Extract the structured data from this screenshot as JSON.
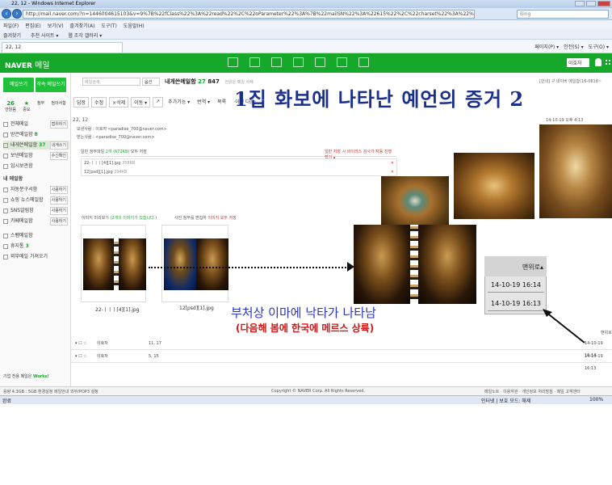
{
  "browser": {
    "title": "22, 12 - Windows Internet Explorer",
    "url": "http://mail.naver.com/?n=1446004615103&v=9%7B%22fClass%22%3A%22read%22%2C%22oParameter%22%3A%7B%22mailSN%22%3A%22615%22%2C%22charset%22%3A%22%22%2C%22prevNextMail%22%3Atrue%2C%22threadMail%22%3Atrue%2C%22p",
    "search_placeholder": "Bing",
    "menu": [
      "파일(F)",
      "편집(E)",
      "보기(V)",
      "즐겨찾기(A)",
      "도구(T)",
      "도움말(H)"
    ],
    "favorites_label": "즐겨찾기",
    "fav_items": [
      "추천 사이트 ▾",
      "웹 조각 갤러리 ▾"
    ],
    "tab_label": "22, 12",
    "tab_tools": [
      "페이지(P) ▾",
      "안전(S) ▾",
      "도구(O) ▾"
    ]
  },
  "naver": {
    "logo": "NAVER",
    "logo_sub": "메일",
    "user_label": "이호자"
  },
  "sidebar": {
    "write_button": "메일쓰기",
    "self_button": "작속 메일쓰기",
    "stats": [
      {
        "value": "26",
        "label": "안읽음"
      },
      {
        "value": "★",
        "label": "중요"
      },
      {
        "value": "",
        "label": "첨부"
      },
      {
        "value": "",
        "label": "첨아서함"
      }
    ],
    "mailboxes": [
      {
        "label": "전체메일",
        "count": "",
        "side": "캡위하기"
      },
      {
        "label": "받은메일함",
        "count": "8",
        "side": ""
      },
      {
        "label": "내게쓴메일함",
        "count": "37",
        "side": "내게쓰기"
      },
      {
        "label": "보낸메일함",
        "count": "",
        "side": "수신확인"
      },
      {
        "label": "임시보관함",
        "count": "",
        "side": ""
      }
    ],
    "my_section": "내 메일함",
    "my_boxes": [
      {
        "label": "자동분구서함",
        "side": "사용하기"
      },
      {
        "label": "쇼핑 뉴스메일함",
        "side": "사용하기"
      },
      {
        "label": "SNS알림함",
        "side": "사용하기"
      },
      {
        "label": "카페메일함",
        "side": "사용하기"
      }
    ],
    "other_boxes": [
      {
        "label": "스팸메일함",
        "count": ""
      },
      {
        "label": "휴지통",
        "count": "3"
      },
      {
        "label": "외부메일 가져오기",
        "count": ""
      }
    ],
    "footer": "기업 전용 메일은",
    "footer_brand": "Works!"
  },
  "mail": {
    "search_placeholder": "메일검색",
    "search_option": "옵션",
    "folder": "내게쓴메일함",
    "folder_count": "27",
    "folder_total": "847",
    "folder_hint": "안읽은 메일 삭제",
    "right_info": "[안내] 구 네이버 메일함(16-0818~",
    "toolbar": [
      "답장",
      "수정",
      "×삭제",
      "이동 ▾",
      "↗",
      "추가기능 ▾",
      "번역 ▾",
      "목록",
      "·이전 다음·"
    ],
    "date": "22, 12",
    "date_right": "14-10-19 오후 4:13",
    "sender_label": "보낸사람 : ",
    "sender": "이호자 <paradise_700@naver.com>",
    "receiver_label": "받는사람 : ",
    "receiver": "<paradise_700@naver.com>",
    "attach_title": "일반 첨부파일",
    "attach_count": "2개 (672KB)",
    "attach_save": "모두 저장",
    "attach_note": "일반 저장 시 바이러스 검사가 자동 진행",
    "attach_note2": "접기 ▴",
    "attachments": [
      "22-ㅣㅣㅣ[4][1].jpg",
      "12[psd][1].jpg"
    ],
    "attachment_sizes": [
      "358KB",
      "294KB"
    ],
    "preview_head": "이미지 미리보기",
    "preview_count": "(2개의 이미지가 있습니다.)",
    "preview_tools": "사진 첨부를 편집하",
    "preview_tools2": "이미지 모두 저장",
    "thumbs": [
      "22-ㅣㅣㅣ[4][1].jpg",
      "12[psd][1].jpg"
    ],
    "list_rows": [
      {
        "sender": "이호자",
        "subject": "11, 17",
        "date": "14-10-19 16:14"
      },
      {
        "sender": "이호자",
        "subject": "5, 15",
        "date": "14-10-19 16:13"
      }
    ],
    "more_label": "맨위로"
  },
  "overlay": {
    "title": "1집 화보에 나타난 예언의 증거 2",
    "caption": "부처상 이마에 낙타가 나타남",
    "subcaption": "(다음해 봄에 한국에 메르스 상륙)",
    "ts_header": "맨위로▴",
    "timestamps": [
      "14-10-19 16:14",
      "14-10-19 16:13"
    ]
  },
  "footer": {
    "left": "용량 4.3GB : 5GB   환경설정   메일안내   외부/POP3 설정",
    "center": "Copyright © NAVER Corp. All Rights Reserved.",
    "right": "메일노트 · 이용약관 · 개인정보 처리방침 · 메일 고객센터"
  },
  "status": {
    "left": "완료",
    "zone": "인터넷 | 보호 모드: 해제",
    "zoom": "100%"
  }
}
